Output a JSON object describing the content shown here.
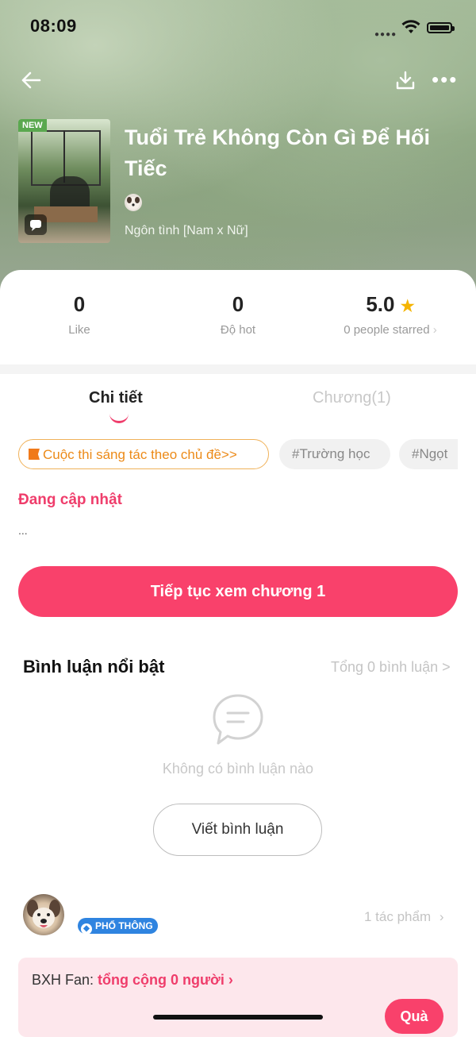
{
  "status_bar": {
    "time": "08:09"
  },
  "book": {
    "badge": "NEW",
    "title": "Tuổi Trẻ Không Còn Gì Để Hối Tiếc",
    "genre": "Ngôn tình [Nam x Nữ]"
  },
  "stats": {
    "likes": {
      "value": "0",
      "label": "Like"
    },
    "hot": {
      "value": "0",
      "label": "Độ hot"
    },
    "rating": {
      "value": "5.0",
      "label": "0 people starred"
    }
  },
  "tabs": {
    "details": "Chi tiết",
    "chapters": "Chương(1)"
  },
  "tags": {
    "contest": "Cuộc thi sáng tác theo chủ đề>>",
    "items": [
      "#Trường học",
      "#Ngọt"
    ]
  },
  "summary": {
    "status": "Đang cập nhật",
    "text": "..."
  },
  "cta": {
    "label": "Tiếp tục xem chương 1"
  },
  "comments": {
    "title": "Bình luận nổi bật",
    "total": "Tổng 0 bình luận >",
    "empty": "Không có bình luận nào",
    "write": "Viết bình luận"
  },
  "author": {
    "rank": "PHỔ THÔNG",
    "works": "1 tác phẩm"
  },
  "fan_rank": {
    "label": "BXH Fan:",
    "count": "tổng cộng 0 người",
    "gift": "Quà"
  },
  "colors": {
    "accent": "#f9416b",
    "contest": "#ec8a18",
    "badge": "#2f84e0"
  }
}
